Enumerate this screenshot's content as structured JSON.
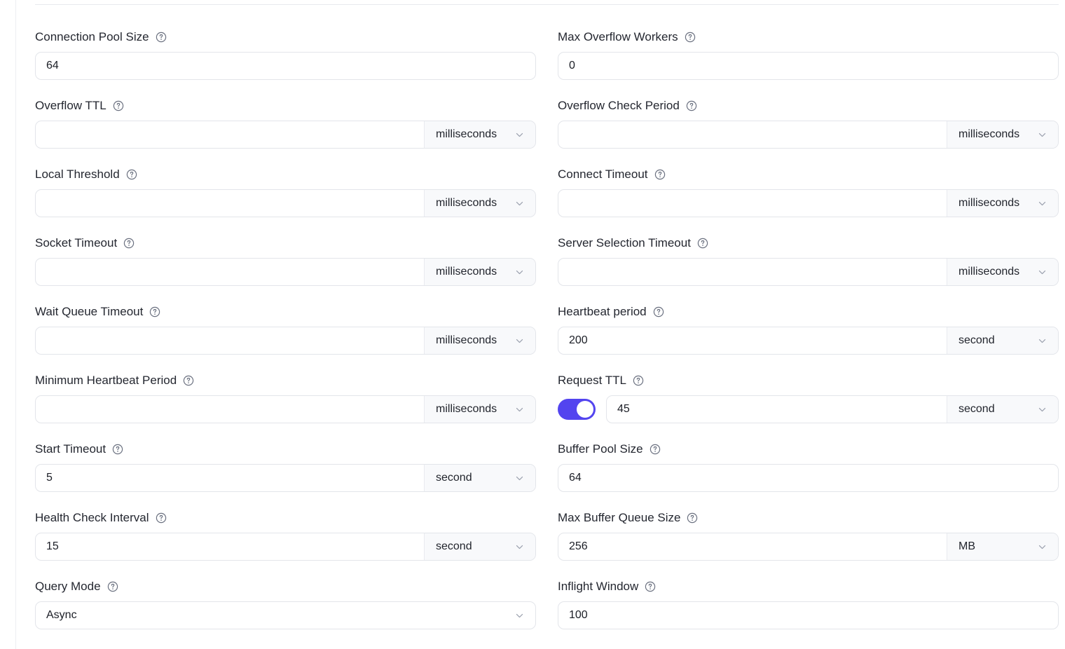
{
  "theme": {
    "accent": "#5344ef",
    "label_color": "#242730",
    "value_color": "#1b1e26",
    "border_color": "#e3e5ea",
    "unit_bg": "#f8f9fb"
  },
  "icons": {
    "help": "help-circle-icon",
    "chevron": "chevron-down-icon"
  },
  "form": {
    "fields": [
      {
        "column": "left",
        "name": "connection-pool-size",
        "label": "Connection Pool Size",
        "type": "number",
        "value": "64",
        "placeholder": "",
        "unit": null,
        "toggle": null
      },
      {
        "column": "right",
        "name": "max-overflow-workers",
        "label": "Max Overflow Workers",
        "type": "number",
        "value": "0",
        "placeholder": "",
        "unit": null,
        "toggle": null
      },
      {
        "column": "left",
        "name": "overflow-ttl",
        "label": "Overflow TTL",
        "type": "number-with-unit",
        "value": "",
        "placeholder": "",
        "unit": "milliseconds",
        "toggle": null
      },
      {
        "column": "right",
        "name": "overflow-check-period",
        "label": "Overflow Check Period",
        "type": "number-with-unit",
        "value": "",
        "placeholder": "",
        "unit": "milliseconds",
        "toggle": null
      },
      {
        "column": "left",
        "name": "local-threshold",
        "label": "Local Threshold",
        "type": "number-with-unit",
        "value": "",
        "placeholder": "",
        "unit": "milliseconds",
        "toggle": null
      },
      {
        "column": "right",
        "name": "connect-timeout",
        "label": "Connect Timeout",
        "type": "number-with-unit",
        "value": "",
        "placeholder": "",
        "unit": "milliseconds",
        "toggle": null
      },
      {
        "column": "left",
        "name": "socket-timeout",
        "label": "Socket Timeout",
        "type": "number-with-unit",
        "value": "",
        "placeholder": "",
        "unit": "milliseconds",
        "toggle": null
      },
      {
        "column": "right",
        "name": "server-selection-timeout",
        "label": "Server Selection Timeout",
        "type": "number-with-unit",
        "value": "",
        "placeholder": "",
        "unit": "milliseconds",
        "toggle": null
      },
      {
        "column": "left",
        "name": "wait-queue-timeout",
        "label": "Wait Queue Timeout",
        "type": "number-with-unit",
        "value": "",
        "placeholder": "",
        "unit": "milliseconds",
        "toggle": null
      },
      {
        "column": "right",
        "name": "heartbeat-period",
        "label": "Heartbeat period",
        "type": "number-with-unit",
        "value": "200",
        "placeholder": "",
        "unit": "second",
        "toggle": null
      },
      {
        "column": "left",
        "name": "minimum-heartbeat-period",
        "label": "Minimum Heartbeat Period",
        "type": "number-with-unit",
        "value": "",
        "placeholder": "",
        "unit": "milliseconds",
        "toggle": null
      },
      {
        "column": "right",
        "name": "request-ttl",
        "label": "Request TTL",
        "type": "number-with-unit",
        "value": "45",
        "placeholder": "",
        "unit": "second",
        "toggle": "on"
      },
      {
        "column": "left",
        "name": "start-timeout",
        "label": "Start Timeout",
        "type": "number-with-unit",
        "value": "5",
        "placeholder": "",
        "unit": "second",
        "toggle": null
      },
      {
        "column": "right",
        "name": "buffer-pool-size",
        "label": "Buffer Pool Size",
        "type": "number",
        "value": "64",
        "placeholder": "",
        "unit": null,
        "toggle": null
      },
      {
        "column": "left",
        "name": "health-check-interval",
        "label": "Health Check Interval",
        "type": "number-with-unit",
        "value": "15",
        "placeholder": "",
        "unit": "second",
        "toggle": null
      },
      {
        "column": "right",
        "name": "max-buffer-queue-size",
        "label": "Max Buffer Queue Size",
        "type": "number-with-unit",
        "value": "256",
        "placeholder": "",
        "unit": "MB",
        "toggle": null
      },
      {
        "column": "left",
        "name": "query-mode",
        "label": "Query Mode",
        "type": "select",
        "value": "Async",
        "placeholder": "",
        "unit": null,
        "toggle": null
      },
      {
        "column": "right",
        "name": "inflight-window",
        "label": "Inflight Window",
        "type": "number",
        "value": "100",
        "placeholder": "",
        "unit": null,
        "toggle": null
      }
    ]
  }
}
